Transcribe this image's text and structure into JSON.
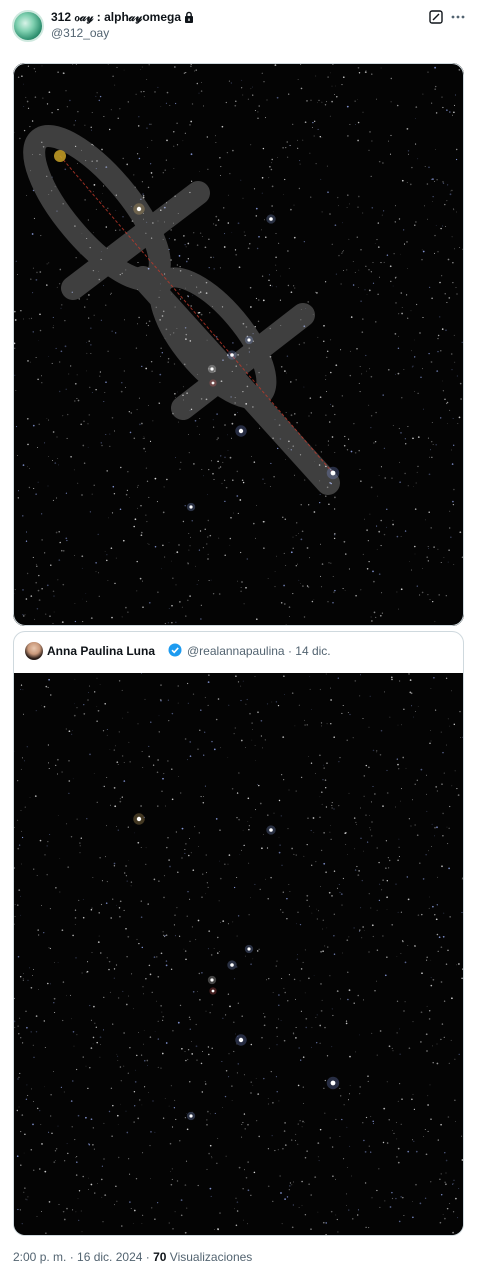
{
  "post": {
    "author_name": "312 ℴ𝒶𝓎 : alph𝒶𝓎omega",
    "author_handle": "@312_oay",
    "locked": true,
    "timestamp": "2:00 p. m. · 16 dic. 2024",
    "dot": " · ",
    "views_count": "70",
    "views_label": "Visualizaciones"
  },
  "quoted": {
    "author_name": "Anna Paulina Luna",
    "verified": true,
    "author_handle": "@realannapaulina",
    "date": "· 14 dic."
  },
  "icons": {
    "grok": "grok-icon",
    "more": "more-icon",
    "lock": "lock-icon",
    "verified": "verified-badge-icon"
  },
  "colors": {
    "text_primary": "#0f1419",
    "text_secondary": "#536471",
    "verified_blue": "#1d9bf0",
    "sky": "#040404"
  }
}
